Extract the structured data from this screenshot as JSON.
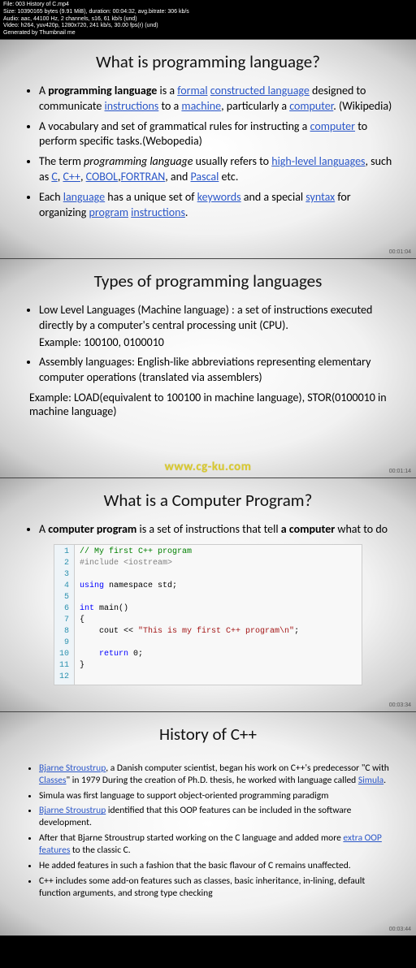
{
  "meta": {
    "file_line": "File: 003 History of C.mp4",
    "size_line": "Size: 10390165 bytes (9.91 MiB), duration: 00:04:32, avg.bitrate: 306 kb/s",
    "audio_line": "Audio: aac, 44100 Hz, 2 channels, s16, 61 kb/s (und)",
    "video_line": "Video: h264, yuv420p, 1280x720, 241 kb/s, 30.00 fps(r) (und)",
    "gen_line": "Generated by Thumbnail me"
  },
  "slide1": {
    "title": "What is programming language?",
    "b1_pre": "A ",
    "b1_bold": "programming language",
    "b1_mid1": " is a ",
    "b1_lnk1": "formal",
    "b1_sp1": " ",
    "b1_lnk2": "constructed language",
    "b1_mid2": " designed to communicate ",
    "b1_lnk3": "instructions",
    "b1_mid3": " to a ",
    "b1_lnk4": "machine",
    "b1_mid4": ", particularly a ",
    "b1_lnk5": "computer",
    "b1_end": ". (Wikipedia)",
    "b2_a": "A vocabulary and set of grammatical rules for instructing a ",
    "b2_lnk": "computer",
    "b2_b": " to perform specific tasks.(Webopedia)",
    "b3_a": "The term ",
    "b3_it": "programming language",
    "b3_b": " usually refers to ",
    "b3_l1": "high-level languages",
    "b3_c": ", such as ",
    "b3_l2": "C",
    "b3_d": ", ",
    "b3_l3": "C++",
    "b3_e": ", ",
    "b3_l4": "COBOL",
    "b3_f": ",",
    "b3_l5": "FORTRAN",
    "b3_g": ", and ",
    "b3_l6": "Pascal",
    "b3_h": " etc.",
    "b4_a": " Each ",
    "b4_l1": "language",
    "b4_b": " has a unique set of ",
    "b4_l2": "keywords",
    "b4_c": " and a special ",
    "b4_l3": "syntax",
    "b4_d": " for organizing ",
    "b4_l4": "program",
    "b4_e": " ",
    "b4_l5": "instructions",
    "b4_f": ".",
    "ts": "00:01:04"
  },
  "slide2": {
    "title": "Types of programming languages",
    "b1": "Low Level Languages (Machine language) : a set of instructions executed directly by a computer's central processing unit (CPU).",
    "b1ex": "Example: 100100, 0100010",
    "b2": "Assembly languages: English-like abbreviations representing elementary computer operations (translated via assemblers)",
    "ex2": "Example: LOAD(equivalent to 100100 in machine language), STOR(0100010 in machine language)",
    "wm": "www.cg-ku.com",
    "ts": "00:01:14"
  },
  "slide3": {
    "title": "What is a Computer Program?",
    "b1_a": "A ",
    "b1_bold1": "computer program",
    "b1_b": " is a set of instructions that tell ",
    "b1_bold2": "a computer",
    "b1_c": " what to do",
    "code": {
      "gutter": "1\n2\n3\n4\n5\n6\n7\n8\n9\n10\n11\n12",
      "l1a": "// My first C++ program",
      "l2a": "#include ",
      "l2b": "<iostream>",
      "l3": "",
      "l4a": "using",
      "l4b": " namespace std;",
      "l5": "",
      "l6a": "int",
      "l6b": " main()",
      "l7": "{",
      "l8a": "    cout << ",
      "l8b": "\"This is my first C++ program\\n\"",
      "l8c": ";",
      "l9": "",
      "l10a": "    return",
      "l10b": " 0;",
      "l11": "}",
      "l12": ""
    },
    "ts": "00:03:34"
  },
  "slide4": {
    "title": "History of C++",
    "b1_l1": "Bjarne Stroustrup",
    "b1_a": ", a Danish computer scientist, began his work on C++'s predecessor \"C with ",
    "b1_l2": "Classes",
    "b1_b": "\" in 1979 During the creation of Ph.D. thesis, he worked with language called ",
    "b1_l3": "Simula",
    "b1_c": ".",
    "b2": "Simula was first language to support object-oriented programming paradigm",
    "b3_l1": "Bjarne Stroustrup",
    "b3_a": " identified that this OOP features can be included in the software development.",
    "b4_a": "After that Bjarne Stroustrup started working on the C language and added more ",
    "b4_l1": "extra OOP features",
    "b4_b": " to the classic C.",
    "b5": "He added features in such a fashion that the basic flavour of C remains unaffected.",
    "b6": "C++ includes some add-on features such as classes, basic inheritance, in-lining, default function arguments, and strong type checking",
    "ts": "00:03:44"
  }
}
